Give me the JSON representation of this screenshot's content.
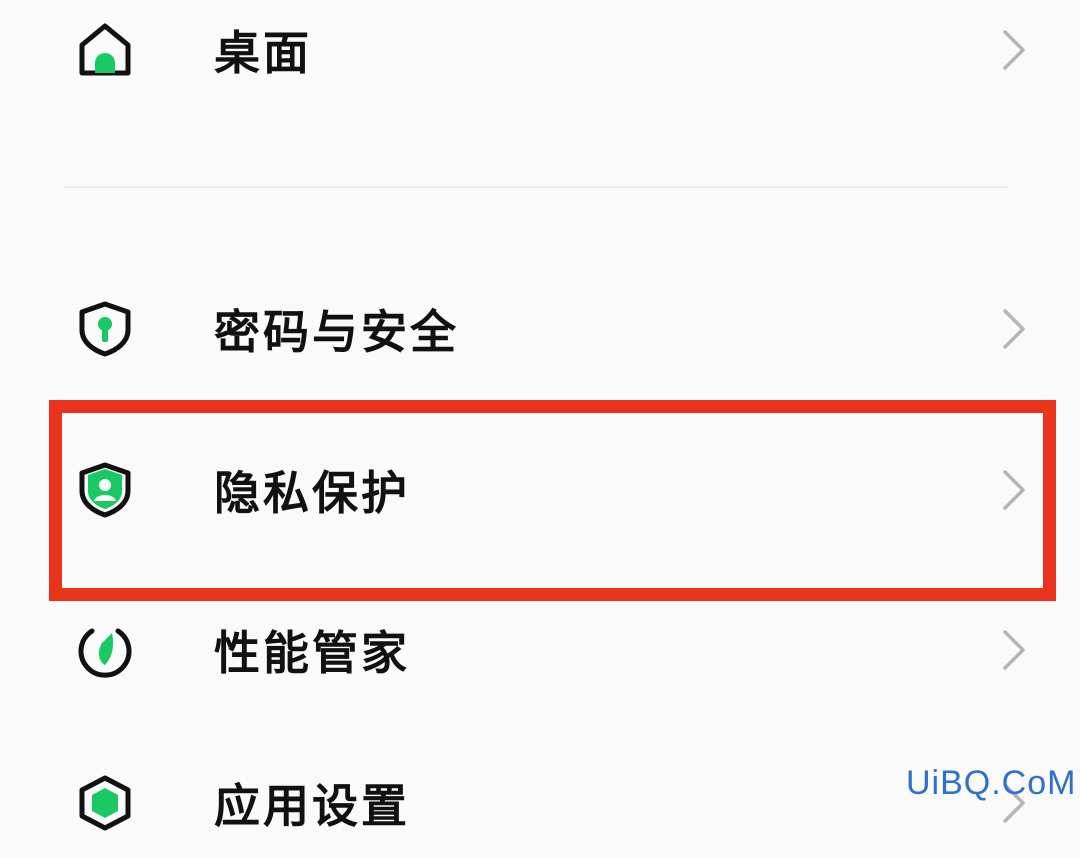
{
  "settings": {
    "items": [
      {
        "id": "desktop",
        "label": "桌面",
        "icon": "home-icon"
      },
      {
        "id": "password-security",
        "label": "密码与安全",
        "icon": "shield-keyhole-icon"
      },
      {
        "id": "privacy",
        "label": "隐私保护",
        "icon": "shield-person-icon"
      },
      {
        "id": "performance",
        "label": "性能管家",
        "icon": "gauge-icon"
      },
      {
        "id": "app-settings",
        "label": "应用设置",
        "icon": "hexagon-app-icon"
      }
    ],
    "chevron_icon": "chevron-right-icon"
  },
  "highlight": {
    "target": "privacy",
    "color": "#e8341c"
  },
  "colors": {
    "accent": "#18c964",
    "icon_stroke": "#111111",
    "chevron": "#b5b5b5"
  },
  "watermark": {
    "text": "UiBQ.CoM",
    "color": "#2f6fd0"
  }
}
